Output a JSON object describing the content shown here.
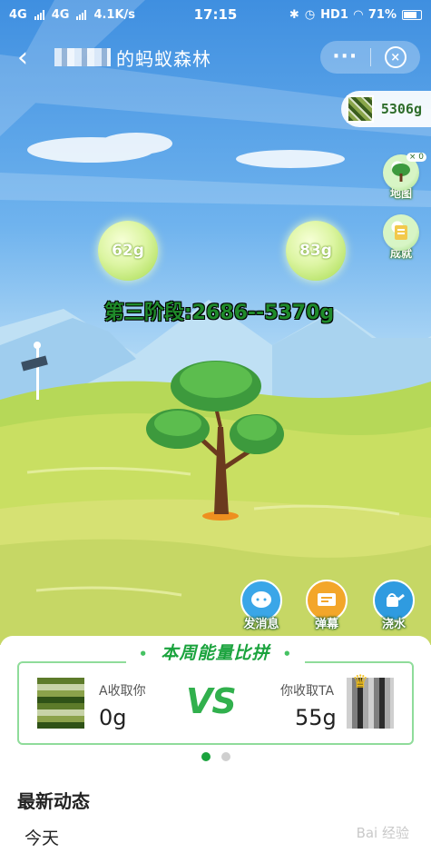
{
  "status_bar": {
    "net1": "4G",
    "net2": "4G",
    "speed": "4.1K/s",
    "time": "17:15",
    "hd": "HD1",
    "battery": "71%"
  },
  "header": {
    "back_icon": "chevron-left-icon",
    "title": "的蚂蚁森林",
    "more_label": "···",
    "close_icon": "close-circle-icon"
  },
  "energy_total": "5306g",
  "side_buttons": [
    {
      "label": "地图",
      "badge": "× 0",
      "icon": "map-tree-icon"
    },
    {
      "label": "成就",
      "icon": "achievement-icon"
    }
  ],
  "bubbles": [
    "62g",
    "83g"
  ],
  "stage_text": "第三阶段:2686--5370g",
  "actions": [
    {
      "label": "发消息",
      "icon": "message-icon",
      "color": "#3aa6e8"
    },
    {
      "label": "弹幕",
      "icon": "danmaku-icon",
      "color": "#f3a62a"
    },
    {
      "label": "浇水",
      "icon": "watering-can-icon",
      "color": "#2f9be0"
    }
  ],
  "vs_card": {
    "title": "本周能量比拼",
    "left_label": "A收取你",
    "left_value": "0g",
    "mark": "VS",
    "right_label": "你收取TA",
    "right_value": "55g"
  },
  "pager": {
    "count": 2,
    "active": 0
  },
  "feed": {
    "heading": "最新动态",
    "today": "今天"
  },
  "watermark": "Bai 经验"
}
